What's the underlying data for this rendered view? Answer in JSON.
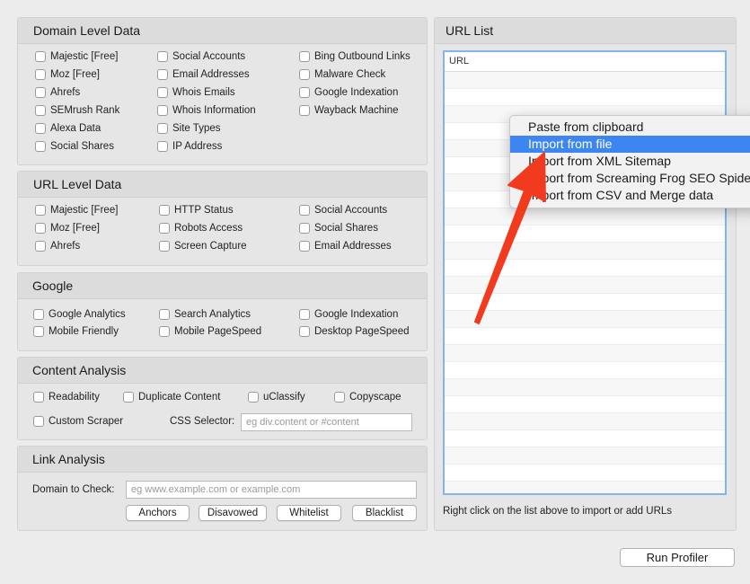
{
  "domain_panel": {
    "title": "Domain Level Data",
    "col1": [
      "Majestic [Free]",
      "Moz [Free]",
      "Ahrefs",
      "SEMrush Rank",
      "Alexa Data",
      "Social Shares"
    ],
    "col2": [
      "Social Accounts",
      "Email Addresses",
      "Whois Emails",
      "Whois Information",
      "Site Types",
      "IP Address"
    ],
    "col3": [
      "Bing Outbound Links",
      "Malware Check",
      "Google Indexation",
      "Wayback Machine"
    ]
  },
  "url_panel": {
    "title": "URL Level Data",
    "col1": [
      "Majestic [Free]",
      "Moz [Free]",
      "Ahrefs"
    ],
    "col2": [
      "HTTP Status",
      "Robots Access",
      "Screen Capture"
    ],
    "col3": [
      "Social Accounts",
      "Social Shares",
      "Email Addresses"
    ]
  },
  "google_panel": {
    "title": "Google",
    "col1": [
      "Google Analytics",
      "Mobile Friendly"
    ],
    "col2": [
      "Search Analytics",
      "Mobile PageSpeed"
    ],
    "col3": [
      "Google Indexation",
      "Desktop PageSpeed"
    ]
  },
  "content_panel": {
    "title": "Content Analysis",
    "row1": [
      "Readability",
      "Duplicate Content",
      "uClassify",
      "Copyscape"
    ],
    "custom_scraper": "Custom Scraper",
    "css_selector_label": "CSS Selector:",
    "css_selector_placeholder": "eg div.content or #content"
  },
  "link_panel": {
    "title": "Link Analysis",
    "domain_label": "Domain to Check:",
    "domain_placeholder": "eg www.example.com or example.com",
    "buttons": [
      "Anchors",
      "Disavowed",
      "Whitelist",
      "Blacklist"
    ]
  },
  "url_list": {
    "title": "URL List",
    "column_header": "URL",
    "note": "Right click on the list above to import or add URLs"
  },
  "context_menu": {
    "items": [
      "Paste from clipboard",
      "Import from file",
      "Import from XML Sitemap",
      "Import from Screaming Frog SEO Spider",
      "Import from CSV and Merge data"
    ],
    "active_index": 1
  },
  "annotation": {
    "color": "#f23a1f"
  },
  "run_button": "Run Profiler"
}
